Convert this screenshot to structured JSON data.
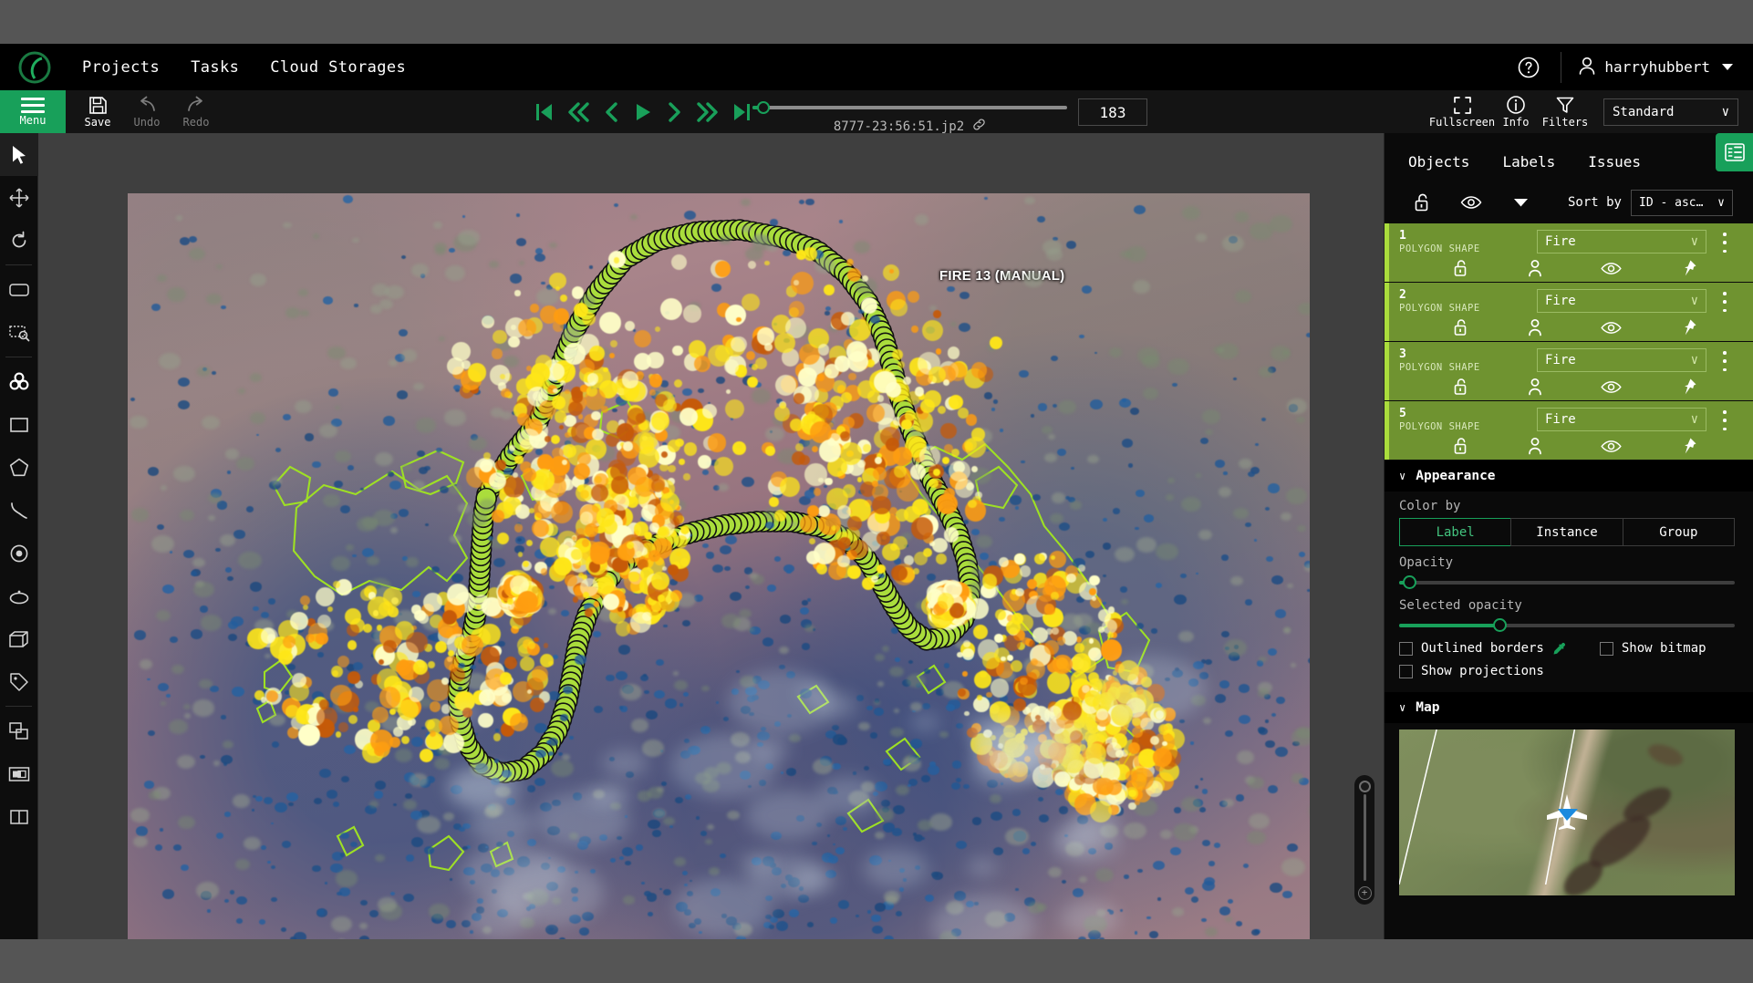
{
  "header": {
    "logo_name": "cvat-logo",
    "nav": [
      {
        "label": "Projects"
      },
      {
        "label": "Tasks"
      },
      {
        "label": "Cloud Storages"
      }
    ],
    "help_icon": "question-circle-icon",
    "user_icon": "user-icon",
    "username": "harryhubbert"
  },
  "toolbar": {
    "menu_label": "Menu",
    "save_label": "Save",
    "undo_label": "Undo",
    "redo_label": "Redo",
    "playback": [
      {
        "name": "first-frame-button",
        "glyph": "first"
      },
      {
        "name": "back-multiple-frames-button",
        "glyph": "rewind"
      },
      {
        "name": "previous-frame-button",
        "glyph": "prev"
      },
      {
        "name": "play-button",
        "glyph": "play"
      },
      {
        "name": "next-frame-button",
        "glyph": "next"
      },
      {
        "name": "forward-multiple-frames-button",
        "glyph": "forward"
      },
      {
        "name": "last-frame-button",
        "glyph": "last"
      }
    ],
    "frame_name": "8777-23:56:51.jp2",
    "frame_link_icon": "link-icon",
    "frame_number": "183",
    "frame_slider_percent": 1,
    "fullscreen_label": "Fullscreen",
    "info_label": "Info",
    "filters_label": "Filters",
    "workspace_value": "Standard"
  },
  "tools": [
    {
      "name": "cursor-tool",
      "active": true
    },
    {
      "name": "move-image-tool",
      "active": false
    },
    {
      "name": "rotate-tool",
      "active": false
    },
    {
      "name": "fit-image-tool",
      "active": false
    },
    {
      "name": "select-region-tool",
      "active": false
    },
    {
      "name": "ai-tools-tool",
      "active": false
    },
    {
      "name": "draw-rectangle-tool",
      "active": false
    },
    {
      "name": "draw-polygon-tool",
      "active": false
    },
    {
      "name": "draw-polyline-tool",
      "active": false
    },
    {
      "name": "draw-points-tool",
      "active": false
    },
    {
      "name": "draw-ellipse-tool",
      "active": false
    },
    {
      "name": "draw-cuboid-tool",
      "active": false
    },
    {
      "name": "setup-tag-tool",
      "active": false
    },
    {
      "name": "merge-shapes-tool",
      "active": false
    },
    {
      "name": "split-track-tool",
      "active": false
    },
    {
      "name": "group-shapes-tool",
      "active": false
    }
  ],
  "canvas": {
    "annotation_label": "FIRE 13 (MANUAL)",
    "selected_polygon_color": "#aadd3c",
    "polygon_outline_color": "#9ee024",
    "zoom_plus_label": "+"
  },
  "sidebar": {
    "panel_toggle_icon": "collapse-sidebar-icon",
    "tabs": [
      {
        "label": "Objects",
        "active": true
      },
      {
        "label": "Labels",
        "active": false
      },
      {
        "label": "Issues",
        "active": false
      }
    ],
    "controls": {
      "lock_icon": "unlock-icon",
      "hidden_icon": "eye-icon",
      "expand_icon": "chevron-down-icon",
      "sort_label": "Sort by",
      "sort_value": "ID - asc…"
    },
    "objects": [
      {
        "id": "1",
        "type": "POLYGON SHAPE",
        "label": "Fire"
      },
      {
        "id": "2",
        "type": "POLYGON SHAPE",
        "label": "Fire"
      },
      {
        "id": "3",
        "type": "POLYGON SHAPE",
        "label": "Fire"
      },
      {
        "id": "5",
        "type": "POLYGON SHAPE",
        "label": "Fire"
      }
    ],
    "object_row_icons": {
      "lock": "lock-open-icon",
      "occluded": "person-icon",
      "hidden": "eye-icon",
      "pinned": "pin-icon",
      "menu": "more-options-icon"
    },
    "appearance": {
      "title": "Appearance",
      "color_by_label": "Color by",
      "color_by_options": [
        {
          "label": "Label",
          "selected": true
        },
        {
          "label": "Instance",
          "selected": false
        },
        {
          "label": "Group",
          "selected": false
        }
      ],
      "opacity_label": "Opacity",
      "opacity_percent": 3,
      "selected_opacity_label": "Selected opacity",
      "selected_opacity_percent": 30,
      "checkboxes": [
        {
          "label": "Outlined borders",
          "checked": false,
          "icon": "eyedropper-icon"
        },
        {
          "label": "Show bitmap",
          "checked": false
        },
        {
          "label": "Show projections",
          "checked": false
        }
      ]
    },
    "map": {
      "title": "Map",
      "marker_icon": "airplane-icon",
      "marker_color": "#1c8ade"
    }
  },
  "colors": {
    "accent_green": "#18a05a",
    "object_row": "#6f9330",
    "object_row_bar": "#aadd3c",
    "header_bg": "#000000",
    "toolbar_bg": "#141414",
    "page_bg": "#555555"
  }
}
